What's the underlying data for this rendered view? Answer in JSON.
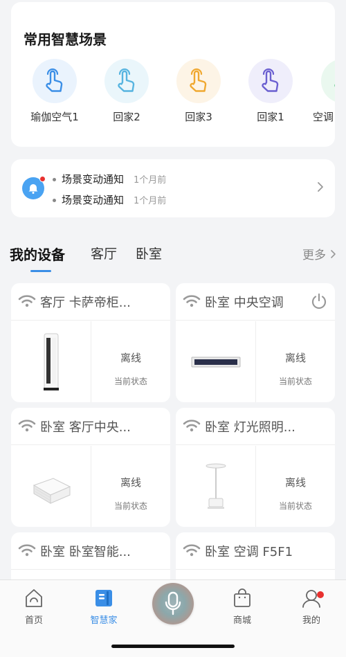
{
  "scenes": {
    "title": "常用智慧场景",
    "items": [
      {
        "label": "瑜伽空气1",
        "color": "#3a8ee6",
        "bg": "#eaf3fd"
      },
      {
        "label": "回家2",
        "color": "#56b4e0",
        "bg": "#eaf6fb"
      },
      {
        "label": "回家3",
        "color": "#f0a830",
        "bg": "#fdf4e6"
      },
      {
        "label": "回家1",
        "color": "#6a5fd0",
        "bg": "#efeefb"
      },
      {
        "label": "空调",
        "color": "#4cc07a",
        "bg": "#eaf8ef"
      }
    ]
  },
  "notice": {
    "lines": [
      {
        "text": "场景变动通知",
        "time": "1个月前"
      },
      {
        "text": "场景变动通知",
        "time": "1个月前"
      }
    ]
  },
  "devices": {
    "tabs": [
      "我的设备",
      "客厅",
      "卧室"
    ],
    "more": "更多",
    "cards": [
      {
        "name": "客厅 卡萨帝柜...",
        "status": "离线",
        "status_label": "当前状态",
        "power": false
      },
      {
        "name": "卧室 中央空调",
        "status": "离线",
        "status_label": "当前状态",
        "power": true
      },
      {
        "name": "卧室 客厅中央...",
        "status": "离线",
        "status_label": "当前状态",
        "power": false
      },
      {
        "name": "卧室 灯光照明...",
        "status": "离线",
        "status_label": "当前状态",
        "power": false
      },
      {
        "name": "卧室 卧室智能...",
        "status": "",
        "status_label": "",
        "power": false
      },
      {
        "name": "卧室 空调 F5F1",
        "status": "",
        "status_label": "",
        "power": false
      }
    ]
  },
  "tabbar": {
    "items": [
      "首页",
      "智慧家",
      "商城",
      "我的"
    ],
    "active_color": "#3a8ee6"
  }
}
